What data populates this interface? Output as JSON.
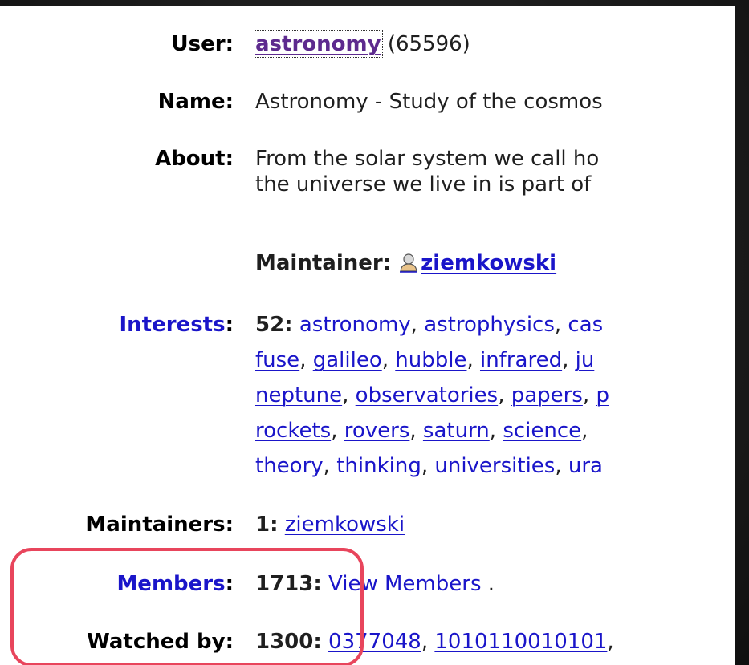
{
  "user": {
    "label": "User:",
    "username": "astronomy",
    "id": "(65596)"
  },
  "name": {
    "label": "Name:",
    "value": "Astronomy - Study of the cosmos"
  },
  "about": {
    "label": "About:",
    "line1": "From the solar system we call ho",
    "line2": "the universe we live in is part of"
  },
  "maintainer": {
    "label": "Maintainer:",
    "icon": "user-icon",
    "name": "ziemkowski"
  },
  "interests": {
    "label": "Interests",
    "colon": ":",
    "count": "52:",
    "lines": [
      [
        "astronomy",
        "astrophysics",
        "cas"
      ],
      [
        "fuse",
        "galileo",
        "hubble",
        "infrared",
        "ju"
      ],
      [
        "neptune",
        "observatories",
        "papers",
        "p"
      ],
      [
        "rockets",
        "rovers",
        "saturn",
        "science",
        ""
      ],
      [
        "theory",
        "thinking",
        "universities",
        "ura"
      ]
    ]
  },
  "maintainers": {
    "label": "Maintainers:",
    "count": "1:",
    "name": "ziemkowski"
  },
  "members": {
    "label": "Members",
    "colon": ":",
    "count": "1713:",
    "link": "View Members ",
    "trailing": "."
  },
  "watched_by": {
    "label": "Watched by:",
    "count": "1300:",
    "users": [
      "0377048",
      "1010110010101"
    ],
    "trailing": ","
  },
  "colors": {
    "link": "#1a15c9",
    "visited_link": "#5d2a8e",
    "highlight": "#e8455c",
    "background": "#1c1c1c"
  }
}
